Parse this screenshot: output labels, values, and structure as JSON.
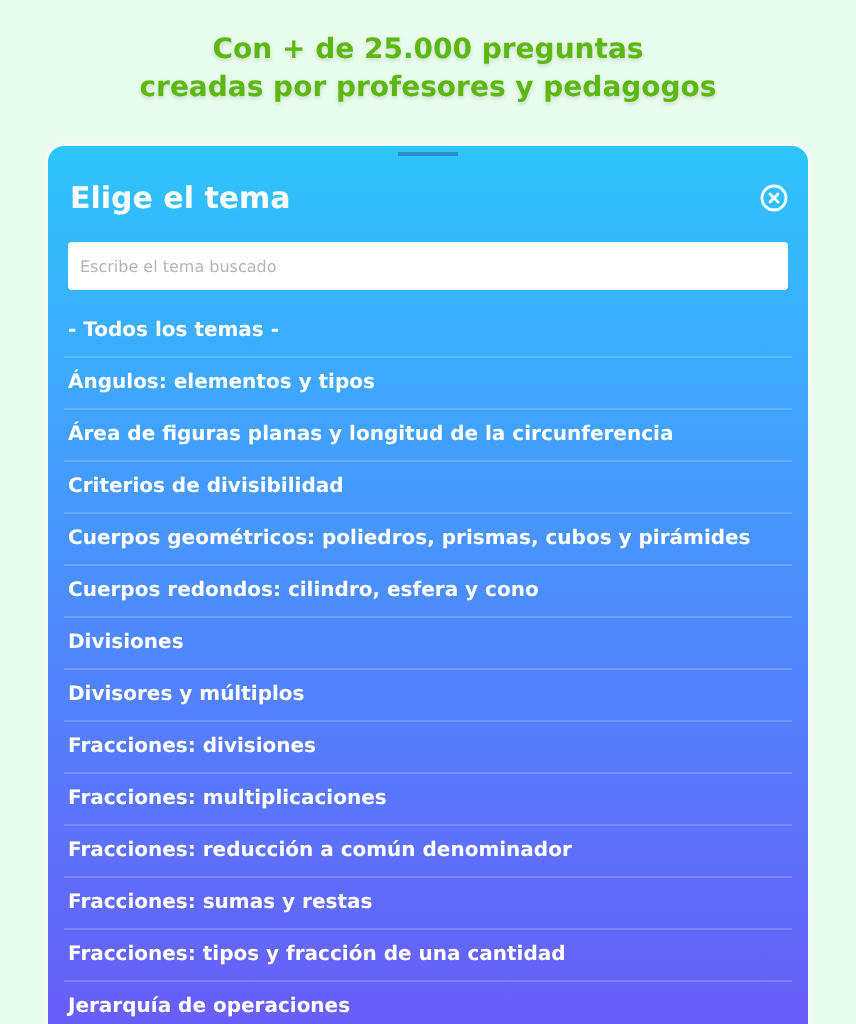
{
  "headline": [
    "Con + de 25.000 preguntas",
    "creadas por profesores y pedagogos"
  ],
  "dialog": {
    "title": "Elige el tema",
    "search": {
      "placeholder": "Escribe el tema buscado"
    },
    "topics": [
      {
        "label": "- Todos los temas -"
      },
      {
        "label": "Ángulos: elementos y tipos"
      },
      {
        "label": "Área de figuras planas y longitud de la circunferencia"
      },
      {
        "label": "Criterios de divisibilidad"
      },
      {
        "label": "Cuerpos geométricos: poliedros, prismas, cubos y pirámides"
      },
      {
        "label": "Cuerpos redondos: cilindro, esfera y cono"
      },
      {
        "label": "Divisiones"
      },
      {
        "label": "Divisores y múltiplos"
      },
      {
        "label": "Fracciones: divisiones"
      },
      {
        "label": "Fracciones: multiplicaciones"
      },
      {
        "label": "Fracciones: reducción a común denominador"
      },
      {
        "label": "Fracciones: sumas y restas"
      },
      {
        "label": "Fracciones: tipos y fracción de una cantidad"
      },
      {
        "label": "Jerarquía de operaciones"
      }
    ]
  }
}
